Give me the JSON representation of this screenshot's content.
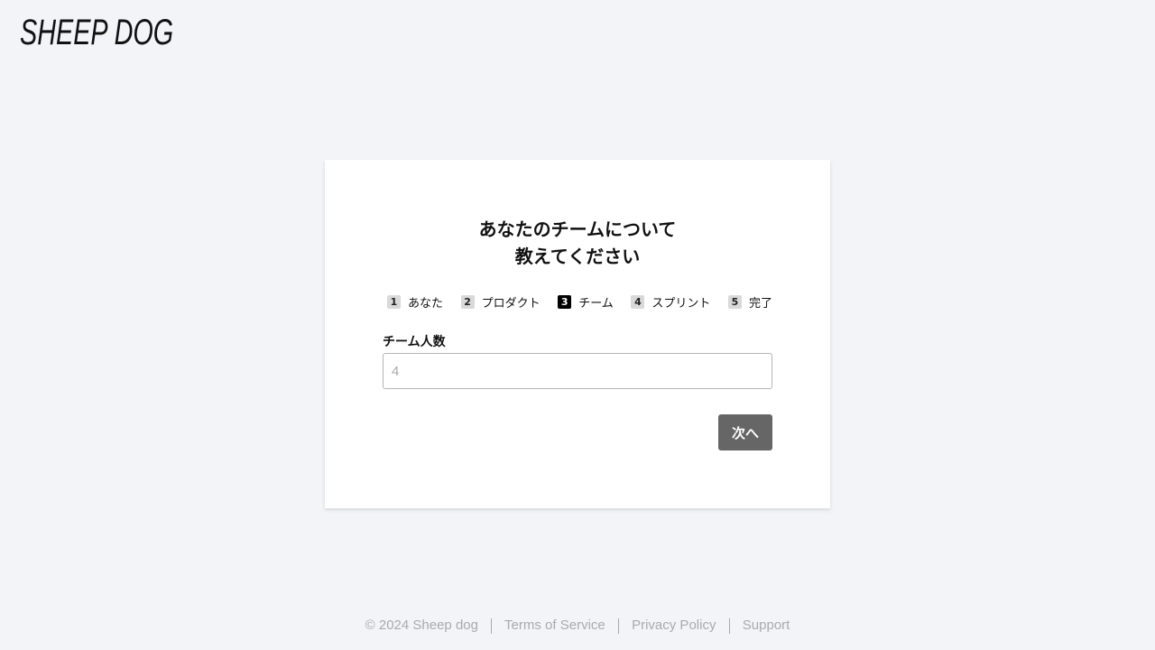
{
  "brand": {
    "logo_text": "SHEEP DOG"
  },
  "card": {
    "title_line1": "あなたのチームについて",
    "title_line2": "教えてください",
    "steps": [
      {
        "number": "1",
        "label": "あなた",
        "active": false
      },
      {
        "number": "2",
        "label": "プロダクト",
        "active": false
      },
      {
        "number": "3",
        "label": "チーム",
        "active": true
      },
      {
        "number": "4",
        "label": "スプリント",
        "active": false
      },
      {
        "number": "5",
        "label": "完了",
        "active": false
      }
    ],
    "team_size": {
      "label": "チーム人数",
      "value": "",
      "placeholder": "4"
    },
    "next_label": "次へ"
  },
  "footer": {
    "copyright": "© 2024 Sheep dog",
    "terms": "Terms of Service",
    "privacy": "Privacy Policy",
    "support": "Support"
  },
  "colors": {
    "background": "#f2f4f7",
    "card": "#ffffff",
    "button": "#666666",
    "active_step": "#000000",
    "inactive_step": "#d9d9d9",
    "footer_text": "#aaaaaa"
  }
}
